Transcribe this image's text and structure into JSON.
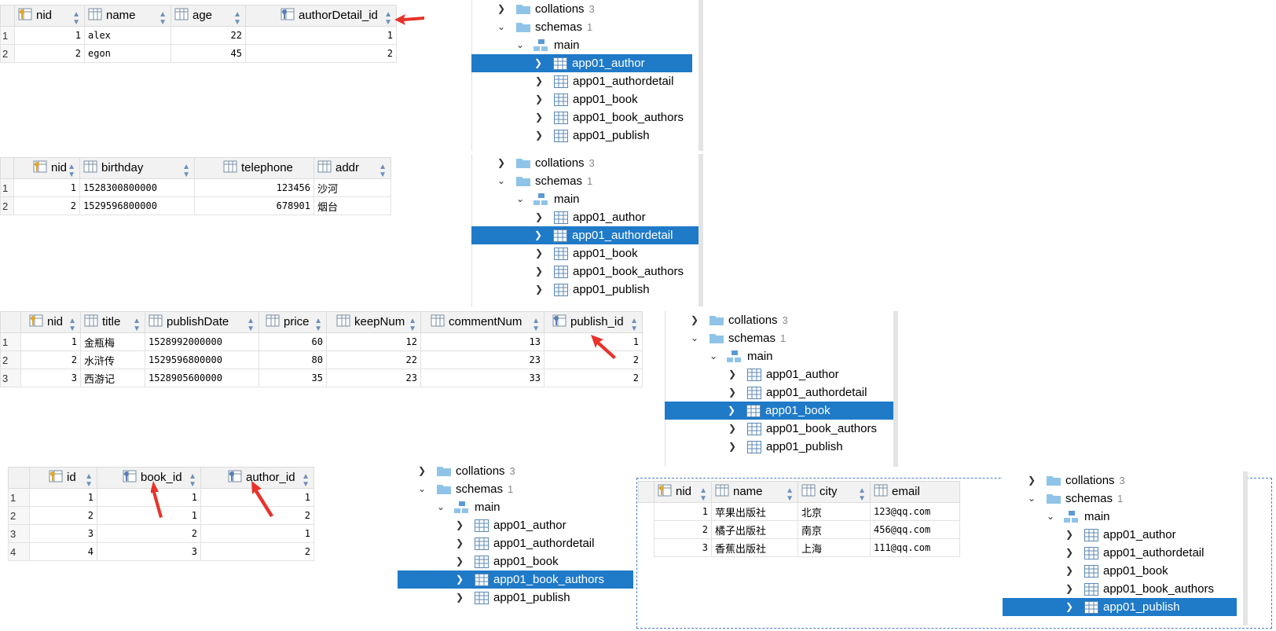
{
  "tree_items": {
    "collations": "collations",
    "collations_count": "3",
    "schemas": "schemas",
    "schemas_count": "1",
    "main": "main",
    "tables": [
      "app01_author",
      "app01_authordetail",
      "app01_book",
      "app01_book_authors",
      "app01_publish"
    ]
  },
  "author_table": {
    "columns": [
      "nid",
      "name",
      "age",
      "authorDetail_id"
    ],
    "rows": [
      [
        "1",
        "1",
        "alex",
        "22",
        "1"
      ],
      [
        "2",
        "2",
        "egon",
        "45",
        "2"
      ]
    ]
  },
  "authordetail_table": {
    "columns": [
      "nid",
      "birthday",
      "telephone",
      "addr"
    ],
    "rows": [
      [
        "1",
        "1",
        "1528300800000",
        "123456",
        "沙河"
      ],
      [
        "2",
        "2",
        "1529596800000",
        "678901",
        "烟台"
      ]
    ]
  },
  "book_table": {
    "columns": [
      "nid",
      "title",
      "publishDate",
      "price",
      "keepNum",
      "commentNum",
      "publish_id"
    ],
    "rows": [
      [
        "1",
        "1",
        "金瓶梅",
        "1528992000000",
        "60",
        "12",
        "13",
        "1"
      ],
      [
        "2",
        "2",
        "水浒传",
        "1529596800000",
        "80",
        "22",
        "23",
        "2"
      ],
      [
        "3",
        "3",
        "西游记",
        "1528905600000",
        "35",
        "23",
        "33",
        "2"
      ]
    ]
  },
  "book_authors_table": {
    "columns": [
      "id",
      "book_id",
      "author_id"
    ],
    "rows": [
      [
        "1",
        "1",
        "1",
        "1"
      ],
      [
        "2",
        "2",
        "1",
        "2"
      ],
      [
        "3",
        "3",
        "2",
        "1"
      ],
      [
        "4",
        "4",
        "3",
        "2"
      ]
    ]
  },
  "publish_table": {
    "columns": [
      "nid",
      "name",
      "city",
      "email"
    ],
    "rows": [
      [
        "1",
        "苹果出版社",
        "北京",
        "123@qq.com"
      ],
      [
        "2",
        "橘子出版社",
        "南京",
        "456@qq.com"
      ],
      [
        "3",
        "香蕉出版社",
        "上海",
        "111@qq.com"
      ]
    ]
  },
  "colors": {
    "selection": "#1f7ac8",
    "arrow": "#e8322a",
    "header_bg": "#f2f2f2"
  }
}
